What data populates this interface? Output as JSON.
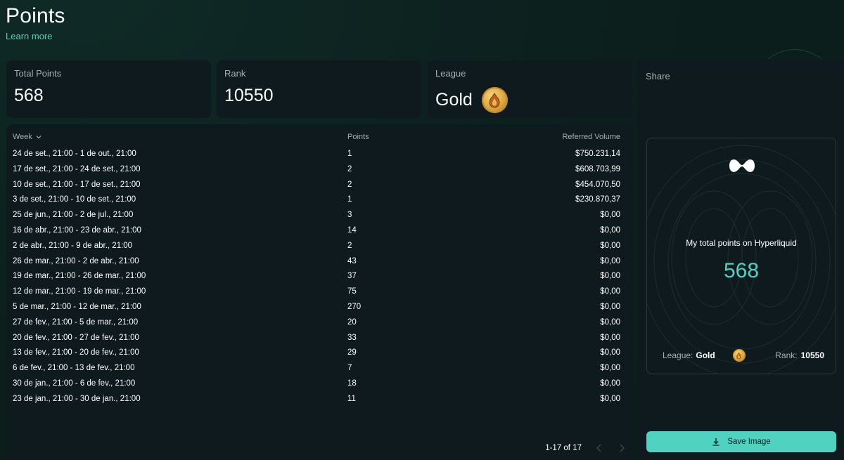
{
  "header": {
    "title": "Points",
    "learn_more": "Learn more"
  },
  "stats": {
    "total_points_label": "Total Points",
    "total_points_value": "568",
    "rank_label": "Rank",
    "rank_value": "10550",
    "league_label": "League",
    "league_value": "Gold"
  },
  "table": {
    "columns": {
      "week": "Week",
      "points": "Points",
      "volume": "Referred Volume"
    },
    "rows": [
      {
        "week": "24 de set., 21:00 - 1 de out., 21:00",
        "points": "1",
        "volume": "$750.231,14"
      },
      {
        "week": "17 de set., 21:00 - 24 de set., 21:00",
        "points": "2",
        "volume": "$608.703,99"
      },
      {
        "week": "10 de set., 21:00 - 17 de set., 21:00",
        "points": "2",
        "volume": "$454.070,50"
      },
      {
        "week": "3 de set., 21:00 - 10 de set., 21:00",
        "points": "1",
        "volume": "$230.870,37"
      },
      {
        "week": "25 de jun., 21:00 - 2 de jul., 21:00",
        "points": "3",
        "volume": "$0,00"
      },
      {
        "week": "16 de abr., 21:00 - 23 de abr., 21:00",
        "points": "14",
        "volume": "$0,00"
      },
      {
        "week": "2 de abr., 21:00 - 9 de abr., 21:00",
        "points": "2",
        "volume": "$0,00"
      },
      {
        "week": "26 de mar., 21:00 - 2 de abr., 21:00",
        "points": "43",
        "volume": "$0,00"
      },
      {
        "week": "19 de mar., 21:00 - 26 de mar., 21:00",
        "points": "37",
        "volume": "$0,00"
      },
      {
        "week": "12 de mar., 21:00 - 19 de mar., 21:00",
        "points": "75",
        "volume": "$0,00"
      },
      {
        "week": "5 de mar., 21:00 - 12 de mar., 21:00",
        "points": "270",
        "volume": "$0,00"
      },
      {
        "week": "27 de fev., 21:00 - 5 de mar., 21:00",
        "points": "20",
        "volume": "$0,00"
      },
      {
        "week": "20 de fev., 21:00 - 27 de fev., 21:00",
        "points": "33",
        "volume": "$0,00"
      },
      {
        "week": "13 de fev., 21:00 - 20 de fev., 21:00",
        "points": "29",
        "volume": "$0,00"
      },
      {
        "week": "6 de fev., 21:00 - 13 de fev., 21:00",
        "points": "7",
        "volume": "$0,00"
      },
      {
        "week": "30 de jan., 21:00 - 6 de fev., 21:00",
        "points": "18",
        "volume": "$0,00"
      },
      {
        "week": "23 de jan., 21:00 - 30 de jan., 21:00",
        "points": "11",
        "volume": "$0,00"
      }
    ],
    "pagination": "1-17 of 17"
  },
  "share": {
    "title": "Share",
    "caption": "My total points on Hyperliquid",
    "points": "568",
    "league_label": "League:",
    "league_value": "Gold",
    "rank_label": "Rank:",
    "rank_value": "10550",
    "save_label": "Save Image"
  },
  "colors": {
    "background": "#0c1f1d",
    "card": "#0f1a1f",
    "accent": "#50d2c1",
    "muted_text": "#a3b0ae",
    "gold": "#d9a43b"
  },
  "icons": [
    "chevron-down-icon",
    "gold-league-icon",
    "hyperliquid-logo-icon",
    "chevron-left-icon",
    "chevron-right-icon",
    "download-icon"
  ]
}
